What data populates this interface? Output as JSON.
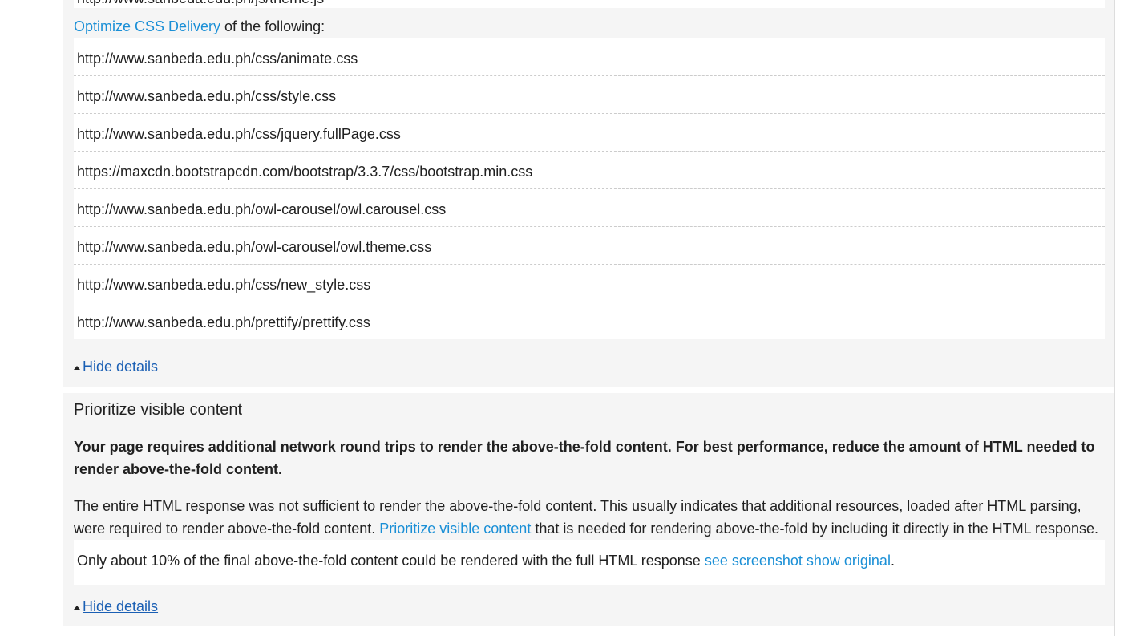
{
  "css_delivery": {
    "cut_off_url": "http://www.sanbeda.edu.ph/js/theme.js",
    "link_text": "Optimize CSS Delivery",
    "intro_suffix": " of the following:",
    "urls": [
      "http://www.sanbeda.edu.ph/css/animate.css",
      "http://www.sanbeda.edu.ph/css/style.css",
      "http://www.sanbeda.edu.ph/css/jquery.fullPage.css",
      "https://maxcdn.bootstrapcdn.com/bootstrap/3.3.7/css/bootstrap.min.css",
      "http://www.sanbeda.edu.ph/owl-carousel/owl.carousel.css",
      "http://www.sanbeda.edu.ph/owl-carousel/owl.theme.css",
      "http://www.sanbeda.edu.ph/css/new_style.css",
      "http://www.sanbeda.edu.ph/prettify/prettify.css"
    ],
    "hide_label": "Hide details"
  },
  "prioritize_visible": {
    "title": "Prioritize visible content",
    "summary": "Your page requires additional network round trips to render the above-the-fold content. For best performance, reduce the amount of HTML needed to render above-the-fold content.",
    "body_prefix": "The entire HTML response was not sufficient to render the above-the-fold content. This usually indicates that additional resources, loaded after HTML parsing, were required to render above-the-fold content. ",
    "body_link": "Prioritize visible content",
    "body_suffix": " that is needed for rendering above-the-fold by including it directly in the HTML response.",
    "note_prefix": "Only about 10% of the final above-the-fold content could be rendered with the full HTML response ",
    "note_link": "see screenshot show original",
    "note_suffix": ".",
    "hide_label": "Hide details"
  },
  "colors": {
    "link": "#1a8fd6",
    "hide_link": "#1a5fb4",
    "panel_bg": "#f5f5f5",
    "text": "#212121"
  },
  "icons": {
    "collapse": "triangle-up-icon"
  }
}
